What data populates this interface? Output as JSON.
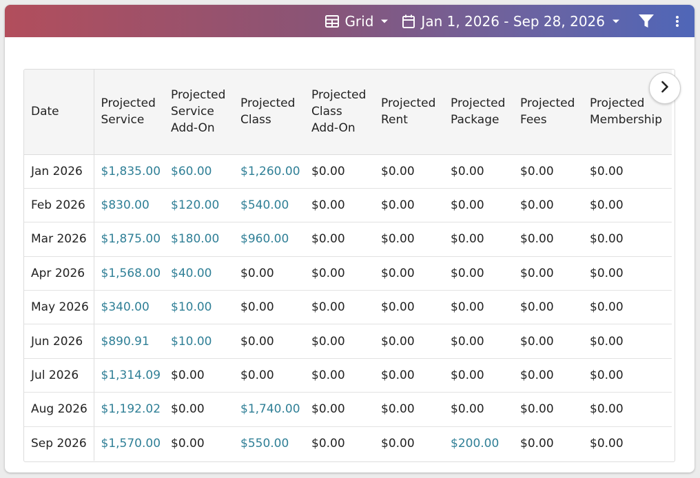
{
  "toolbar": {
    "view_label": "Grid",
    "date_range": "Jan 1, 2026 - Sep 28, 2026"
  },
  "colors": {
    "link": "#2f7f96",
    "header_bg": "#f5f5f5"
  },
  "table": {
    "columns": [
      [
        "Date"
      ],
      [
        "Projected",
        "Service"
      ],
      [
        "Projected",
        "Service",
        "Add-On"
      ],
      [
        "Projected",
        "Class"
      ],
      [
        "Projected",
        "Class",
        "Add-On"
      ],
      [
        "Projected",
        "Rent"
      ],
      [
        "Projected",
        "Package"
      ],
      [
        "Projected",
        "Fees"
      ],
      [
        "Projected",
        "Membership"
      ]
    ],
    "rows": [
      [
        "Jan 2026",
        "$1,835.00",
        "$60.00",
        "$1,260.00",
        "$0.00",
        "$0.00",
        "$0.00",
        "$0.00",
        "$0.00"
      ],
      [
        "Feb 2026",
        "$830.00",
        "$120.00",
        "$540.00",
        "$0.00",
        "$0.00",
        "$0.00",
        "$0.00",
        "$0.00"
      ],
      [
        "Mar 2026",
        "$1,875.00",
        "$180.00",
        "$960.00",
        "$0.00",
        "$0.00",
        "$0.00",
        "$0.00",
        "$0.00"
      ],
      [
        "Apr 2026",
        "$1,568.00",
        "$40.00",
        "$0.00",
        "$0.00",
        "$0.00",
        "$0.00",
        "$0.00",
        "$0.00"
      ],
      [
        "May 2026",
        "$340.00",
        "$10.00",
        "$0.00",
        "$0.00",
        "$0.00",
        "$0.00",
        "$0.00",
        "$0.00"
      ],
      [
        "Jun 2026",
        "$890.91",
        "$10.00",
        "$0.00",
        "$0.00",
        "$0.00",
        "$0.00",
        "$0.00",
        "$0.00"
      ],
      [
        "Jul 2026",
        "$1,314.09",
        "$0.00",
        "$0.00",
        "$0.00",
        "$0.00",
        "$0.00",
        "$0.00",
        "$0.00"
      ],
      [
        "Aug 2026",
        "$1,192.02",
        "$0.00",
        "$1,740.00",
        "$0.00",
        "$0.00",
        "$0.00",
        "$0.00",
        "$0.00"
      ],
      [
        "Sep 2026",
        "$1,570.00",
        "$0.00",
        "$550.00",
        "$0.00",
        "$0.00",
        "$200.00",
        "$0.00",
        "$0.00"
      ]
    ]
  },
  "icons": {
    "view": "grid-table-icon",
    "view_caret": "caret-down-icon",
    "calendar": "calendar-icon",
    "date_caret": "caret-down-icon",
    "filter": "filter-icon",
    "more": "more-vertical-icon",
    "next": "chevron-right-icon"
  }
}
